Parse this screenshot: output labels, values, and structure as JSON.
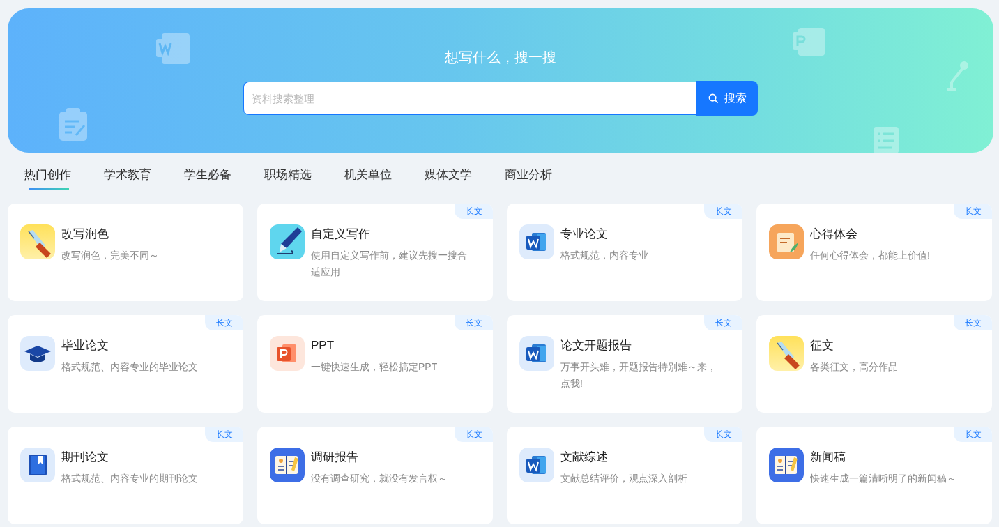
{
  "banner": {
    "title": "想写什么，搜一搜",
    "search": {
      "placeholder": "资料搜索整理"
    },
    "search_button": "搜索"
  },
  "tabs": [
    {
      "label": "热门创作",
      "selected": true
    },
    {
      "label": "学术教育",
      "selected": false
    },
    {
      "label": "学生必备",
      "selected": false
    },
    {
      "label": "职场精选",
      "selected": false
    },
    {
      "label": "机关单位",
      "selected": false
    },
    {
      "label": "媒体文学",
      "selected": false
    },
    {
      "label": "商业分析",
      "selected": false
    }
  ],
  "cards": [
    {
      "kind": "pen",
      "title": "改写润色",
      "description": "改写润色，完美不同～"
    },
    {
      "kind": "marker",
      "title": "自定义写作",
      "description": "使用自定义写作前，建议先搜一搜合适应用",
      "badge": "长文"
    },
    {
      "kind": "word",
      "title": "专业论文",
      "description": "格式规范，内容专业",
      "badge": "长文"
    },
    {
      "kind": "scroll",
      "title": "心得体会",
      "description": "任何心得体会，都能上价值!",
      "badge": "长文"
    },
    {
      "kind": "cap",
      "title": "毕业论文",
      "description": "格式规范、内容专业的毕业论文",
      "badge": "长文"
    },
    {
      "kind": "ppt",
      "title": "PPT",
      "description": "一键快速生成，轻松搞定PPT",
      "badge": "长文"
    },
    {
      "kind": "word",
      "title": "论文开题报告",
      "description": "万事开头难，开题报告特别难～来，点我!",
      "badge": "长文"
    },
    {
      "kind": "pen",
      "title": "征文",
      "description": "各类征文，高分作品",
      "badge": "长文"
    },
    {
      "kind": "journal",
      "title": "期刊论文",
      "description": "格式规范、内容专业的期刊论文",
      "badge": "长文"
    },
    {
      "kind": "notebook",
      "title": "调研报告",
      "description": "没有调查研究，就没有发言权～",
      "badge": "长文"
    },
    {
      "kind": "word",
      "title": "文献综述",
      "description": "文献总结评价，观点深入剖析",
      "badge": "长文"
    },
    {
      "kind": "notebook",
      "title": "新闻稿",
      "description": "快速生成一篇清晰明了的新闻稿～",
      "badge": "长文"
    }
  ]
}
